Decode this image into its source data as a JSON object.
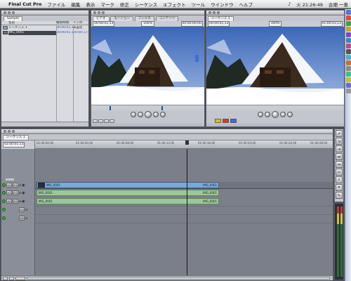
{
  "menubar": {
    "app_name": "Final Cut Pro",
    "items": [
      "ファイル",
      "編集",
      "表示",
      "マーク",
      "修正",
      "シーケンス",
      "エフェクト",
      "ツール",
      "ウインドウ",
      "ヘルプ"
    ],
    "clock": "火 21:26:49",
    "user": "古畑 一恵"
  },
  "browser": {
    "tab": "Sample",
    "columns": {
      "name": "名前",
      "duration": "継続時間",
      "in": "イン点"
    },
    "rows": [
      {
        "name": "シーケンス 1",
        "duration": "00:00:01;13",
        "in": "未設定"
      },
      {
        "name": "IMG_0001",
        "duration": "00:00:01;13",
        "in": "00:00:17;03"
      }
    ]
  },
  "viewer": {
    "tabs": [
      "ビデオ",
      "モーション",
      "フィルタ",
      "コンテンツ"
    ],
    "timecode_left": "00:00:01;13",
    "timecode_right": "00:00:00;00",
    "zoom": "100%"
  },
  "canvas": {
    "tab": "シーケンス 1",
    "timecode_left": "00:00:01;13",
    "timecode_right": "01:00:01;13",
    "zoom": "100%"
  },
  "timeline": {
    "tab": "シーケンス 1",
    "timecode": "01:00:01;13",
    "ruler_ticks": [
      "01:00:00;00",
      "01:00:04;00",
      "01:00:08;00",
      "01:00:12;00",
      "01:00:16;00",
      "01:00:20;00",
      "01:00:24;00",
      "01:00:28;00"
    ],
    "tracks": [
      {
        "id": "V1",
        "src": "v1",
        "type": "video",
        "clip": "IMG_0001"
      },
      {
        "id": "A1",
        "src": "a1",
        "type": "audio",
        "clip": "IMG_0001"
      },
      {
        "id": "A2",
        "src": "a2",
        "type": "audio",
        "clip": "IMG_0001"
      },
      {
        "id": "A3",
        "src": "",
        "type": "empty",
        "clip": ""
      },
      {
        "id": "A4",
        "src": "",
        "type": "empty",
        "clip": ""
      }
    ],
    "playhead_pos": 0.51
  },
  "colors": {
    "accent": "#3f6fd0",
    "video_clip": "#7aa8d8",
    "audio_clip": "#9cc79a"
  }
}
